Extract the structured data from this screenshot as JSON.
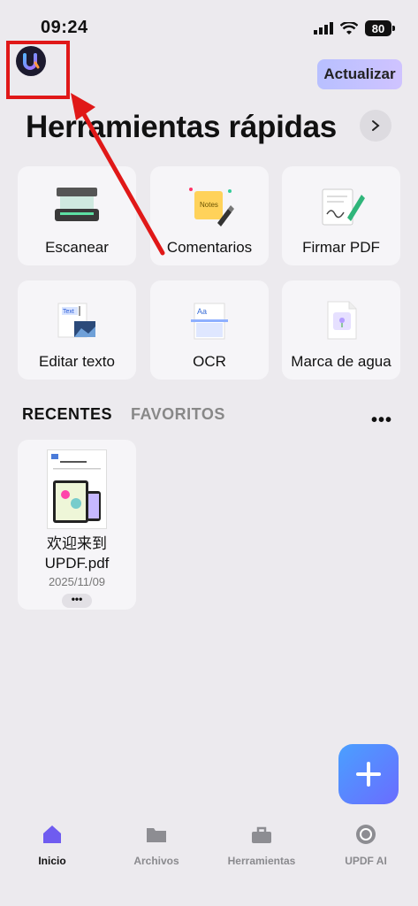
{
  "status_bar": {
    "time": "09:24",
    "battery": "80"
  },
  "header": {
    "upgrade_label": "Actualizar"
  },
  "title": "Herramientas rápidas",
  "tools": [
    {
      "label": "Escanear",
      "icon": "scanner-icon"
    },
    {
      "label": "Comentarios",
      "icon": "notes-icon"
    },
    {
      "label": "Firmar PDF",
      "icon": "signature-icon"
    },
    {
      "label": "Editar texto",
      "icon": "edit-text-icon"
    },
    {
      "label": "OCR",
      "icon": "ocr-icon"
    },
    {
      "label": "Marca de agua",
      "icon": "watermark-icon"
    }
  ],
  "tabs": {
    "recent": "RECENTES",
    "favorites": "FAVORITOS"
  },
  "recent_files": [
    {
      "name_line1": "欢迎来到",
      "name_line2": "UPDF.pdf",
      "date": "2025/11/09"
    }
  ],
  "nav": [
    {
      "label": "Inicio",
      "icon": "home-icon",
      "active": true
    },
    {
      "label": "Archivos",
      "icon": "folder-icon",
      "active": false
    },
    {
      "label": "Herramientas",
      "icon": "toolbox-icon",
      "active": false
    },
    {
      "label": "UPDF AI",
      "icon": "ai-icon",
      "active": false
    }
  ],
  "colors": {
    "accent": "#6a6cff",
    "highlight": "#e01818",
    "background": "#eceaee"
  }
}
